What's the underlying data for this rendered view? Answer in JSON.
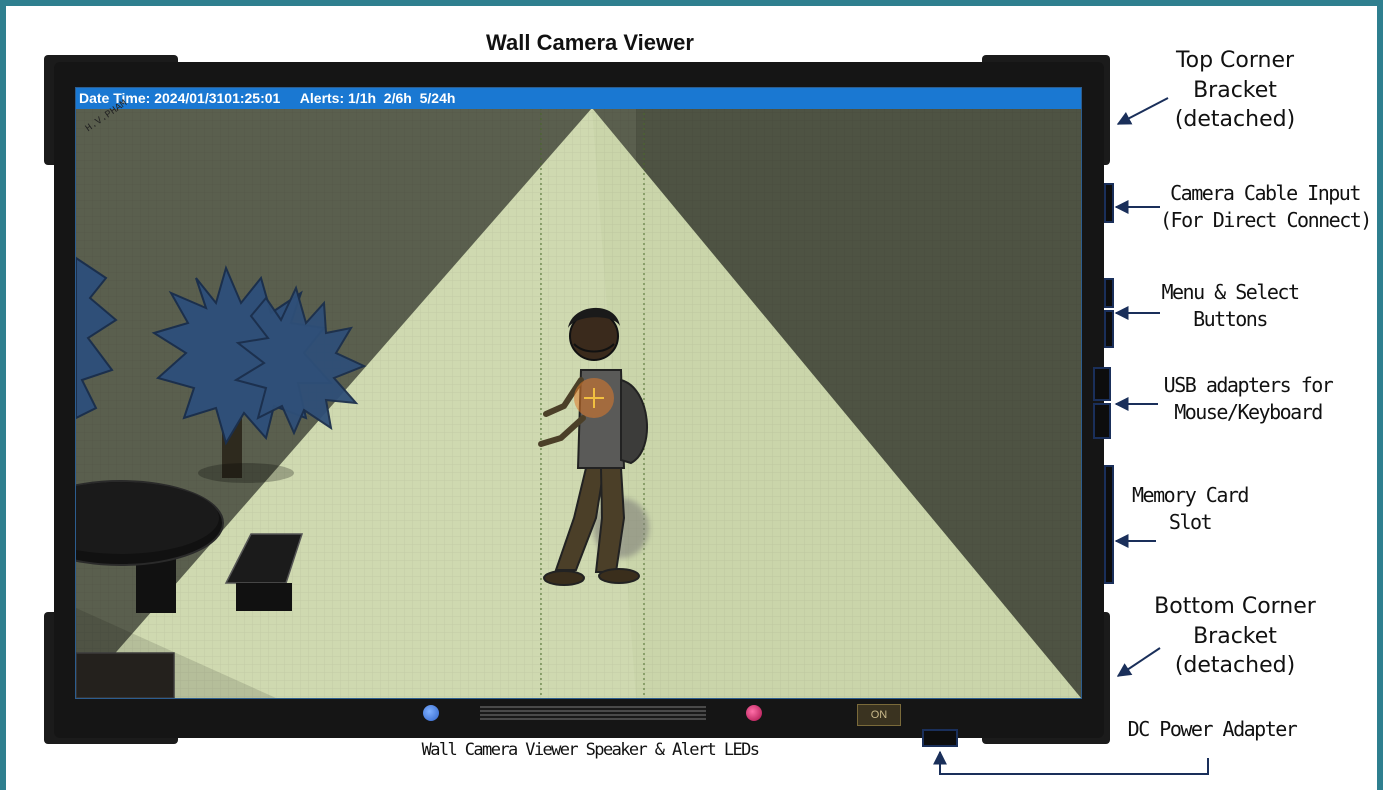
{
  "title": "Wall Camera Viewer",
  "osd": {
    "datetime": "Date Time: 2024/01/3101:25:01",
    "alerts": "Alerts: 1/1h  2/6h  5/24h"
  },
  "watermark": "H.V.PHAM",
  "power_button_label": "ON",
  "speaker_caption": "Wall Camera Viewer Speaker & Alert LEDs",
  "annotations": {
    "top_bracket": [
      "Top Corner",
      "Bracket",
      "(detached)"
    ],
    "camera_cable": [
      "Camera Cable Input",
      "(For Direct Connect)"
    ],
    "menu_buttons": [
      "Menu & Select",
      "Buttons"
    ],
    "usb": [
      "USB adapters for",
      "Mouse/Keyboard"
    ],
    "memory_card": [
      "Memory Card",
      "Slot"
    ],
    "bottom_bracket": [
      "Bottom Corner",
      "Bracket",
      "(detached)"
    ],
    "dc_power": "DC Power Adapter"
  },
  "colors": {
    "border": "#2f7f8f",
    "osd_bar": "#1a78d2",
    "wall": "#5a5f4e",
    "light_cone": "#cfd9b0",
    "tree": "#2f4f78",
    "led_blue": "#3a6fd6",
    "led_red": "#c01458"
  }
}
